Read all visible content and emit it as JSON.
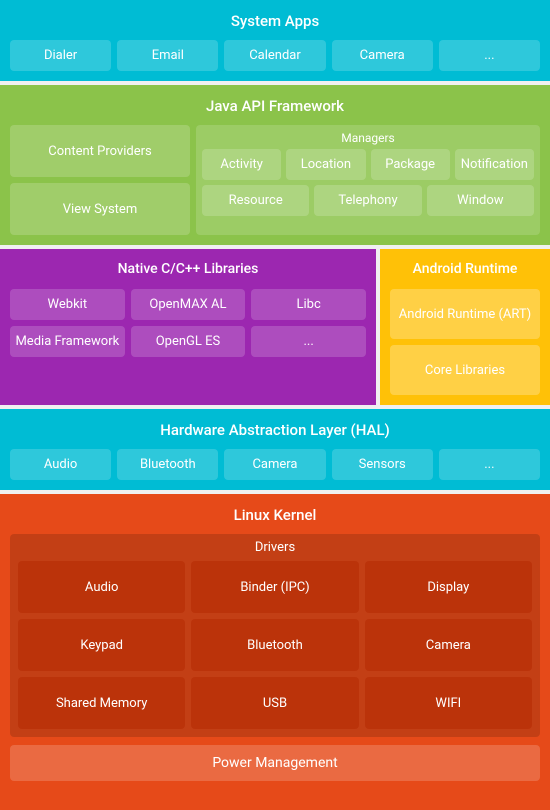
{
  "systemApps": {
    "label": "System Apps",
    "items": [
      "Dialer",
      "Email",
      "Calendar",
      "Camera",
      "..."
    ]
  },
  "javaApi": {
    "label": "Java API Framework",
    "managersLabel": "Managers",
    "contentProviders": "Content Providers",
    "viewSystem": "View System",
    "managersRow1": [
      "Activity",
      "Location",
      "Package",
      "Notification"
    ],
    "managersRow2": [
      "Resource",
      "Telephony",
      "Window"
    ]
  },
  "native": {
    "label": "Native C/C++ Libraries",
    "items": [
      "Webkit",
      "OpenMAX AL",
      "Libc",
      "Media Framework",
      "OpenGL ES",
      "..."
    ]
  },
  "runtime": {
    "label": "Android Runtime",
    "items": [
      "Android Runtime (ART)",
      "Core Libraries"
    ]
  },
  "hal": {
    "label": "Hardware Abstraction Layer (HAL)",
    "items": [
      "Audio",
      "Bluetooth",
      "Camera",
      "Sensors",
      "..."
    ]
  },
  "linux": {
    "label": "Linux Kernel",
    "driversLabel": "Drivers",
    "drivers": [
      "Audio",
      "Binder (IPC)",
      "Display",
      "Keypad",
      "Bluetooth",
      "Camera",
      "Shared Memory",
      "USB",
      "WIFI"
    ],
    "bottomLabel": "Power Management"
  }
}
